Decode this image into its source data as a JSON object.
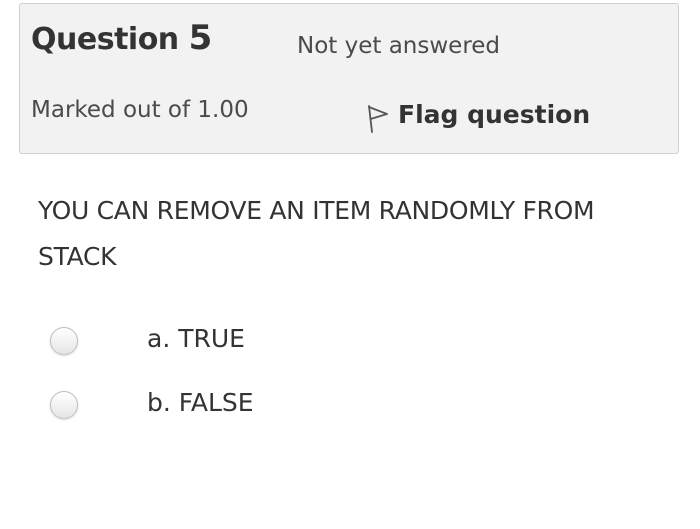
{
  "info": {
    "question_prefix": "Question ",
    "question_number": "5",
    "state": "Not yet answered",
    "grade": "Marked out of 1.00",
    "flag_label": "Flag question",
    "flag_icon": "flag-icon"
  },
  "question": {
    "text": "YOU CAN REMOVE AN ITEM RANDOMLY FROM STACK",
    "options": [
      {
        "label": "a. TRUE",
        "selected": false
      },
      {
        "label": "b. FALSE",
        "selected": false
      }
    ]
  },
  "colors": {
    "info_background": "#f2f2f2",
    "info_border": "#d0d0d0",
    "text": "#333333"
  }
}
